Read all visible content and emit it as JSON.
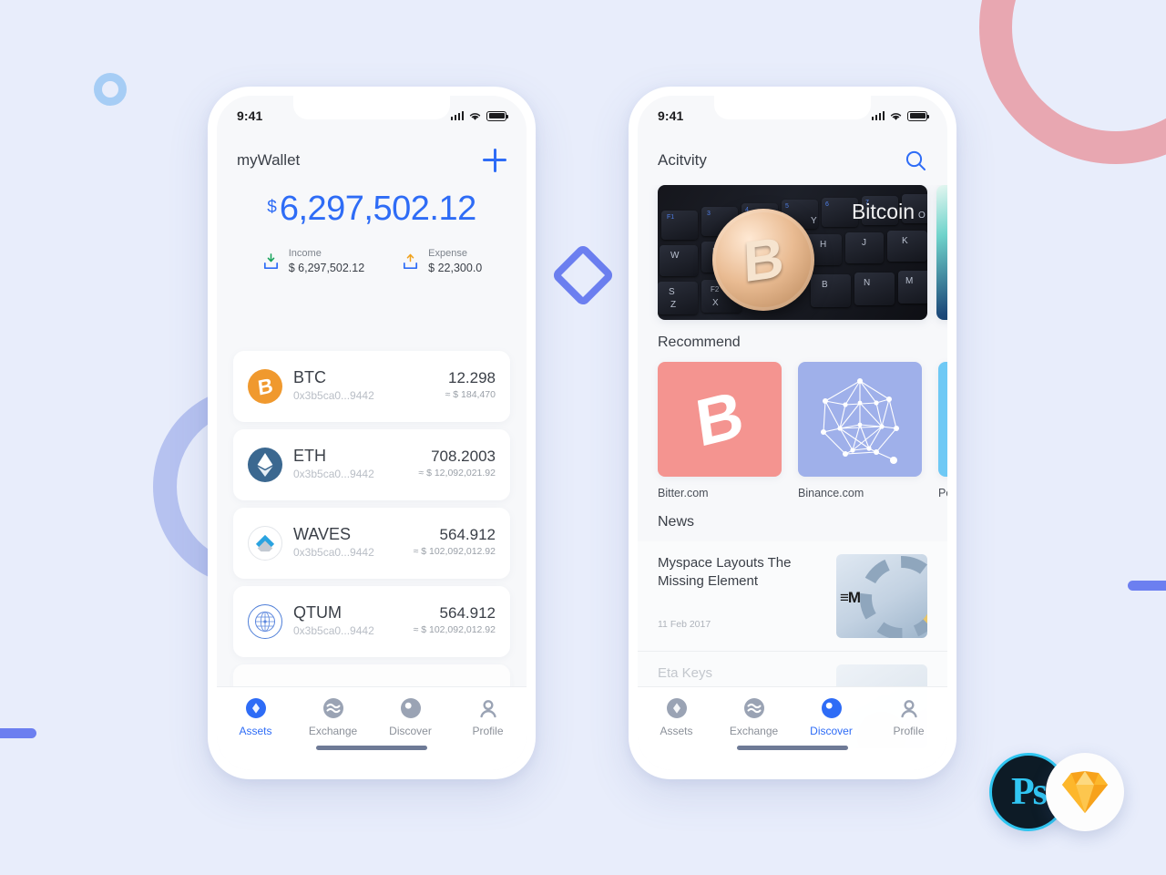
{
  "background": {
    "color": "#e8edfb",
    "decorations": [
      {
        "name": "pink-ring",
        "color": "#e8a7b1"
      },
      {
        "name": "purple-arc",
        "color": "#b6c2f0"
      },
      {
        "name": "blue-circle",
        "color": "#a6cdf5"
      },
      {
        "name": "indigo-diamond",
        "color": "#6c7ff0"
      },
      {
        "name": "indigo-bar-left",
        "color": "#6c7ff0"
      },
      {
        "name": "indigo-bar-right",
        "color": "#6c7ff0"
      }
    ]
  },
  "accent": "#2e6cf6",
  "status_bar": {
    "time": "9:41",
    "signal_icon": "cellular-signal-icon",
    "wifi_icon": "wifi-icon",
    "battery_icon": "battery-icon"
  },
  "wallet_screen": {
    "header": {
      "title": "myWallet",
      "add_icon": "plus-icon"
    },
    "balance": {
      "currency_symbol": "$",
      "amount": "6,297,502.12"
    },
    "summary": [
      {
        "icon": "income-download-icon",
        "label": "Income",
        "value": "$ 6,297,502.12"
      },
      {
        "icon": "expense-upload-icon",
        "label": "Expense",
        "value": "$ 22,300.0"
      }
    ],
    "assets": [
      {
        "symbol": "BTC",
        "icon": "bitcoin-coin-icon",
        "address": "0x3b5ca0...9442",
        "amount": "12.298",
        "fiat": "≈ $ 184,470"
      },
      {
        "symbol": "ETH",
        "icon": "ethereum-coin-icon",
        "address": "0x3b5ca0...9442",
        "amount": "708.2003",
        "fiat": "≈ $ 12,092,021.92"
      },
      {
        "symbol": "WAVES",
        "icon": "waves-coin-icon",
        "address": "0x3b5ca0...9442",
        "amount": "564.912",
        "fiat": "≈ $ 102,092,012.92"
      },
      {
        "symbol": "QTUM",
        "icon": "qtum-coin-icon",
        "address": "0x3b5ca0...9442",
        "amount": "564.912",
        "fiat": "≈ $ 102,092,012.92"
      }
    ]
  },
  "discover_screen": {
    "header": {
      "title": "Acitvity",
      "search_icon": "search-icon"
    },
    "banners": [
      {
        "caption": "Bitcoin",
        "image": "bitcoin-coin-on-keyboard-photo"
      },
      {
        "caption": "",
        "image": "teal-abstract-photo"
      }
    ],
    "recommend": {
      "title": "Recommend",
      "items": [
        {
          "label": "Bitter.com",
          "icon": "bitcoin-b-icon",
          "color": "#f49490"
        },
        {
          "label": "Binance.com",
          "icon": "network-mesh-icon",
          "color": "#9fb0ea"
        },
        {
          "label": "Polon",
          "icon": "poloniex-icon",
          "color": "#6ec9f5"
        }
      ]
    },
    "news": {
      "title": "News",
      "items": [
        {
          "title": "Myspace Layouts The Missing Element",
          "date": "11 Feb 2017",
          "thumb": "ibm-server-ring-photo"
        },
        {
          "title": "Eta Keys",
          "date": "",
          "thumb": "portrait-photo"
        }
      ]
    }
  },
  "tab_bar": {
    "wallet_active": "Assets",
    "discover_active": "Discover",
    "tabs": [
      {
        "label": "Assets",
        "icon": "diamond-assets-icon"
      },
      {
        "label": "Exchange",
        "icon": "exchange-waves-icon"
      },
      {
        "label": "Discover",
        "icon": "discover-compass-icon"
      },
      {
        "label": "Profile",
        "icon": "profile-person-icon"
      }
    ]
  },
  "badges": [
    {
      "name": "photoshop-badge",
      "label": "Ps",
      "color": "#31c6f3"
    },
    {
      "name": "sketch-badge",
      "label": "",
      "color": "#f7a21b"
    }
  ]
}
